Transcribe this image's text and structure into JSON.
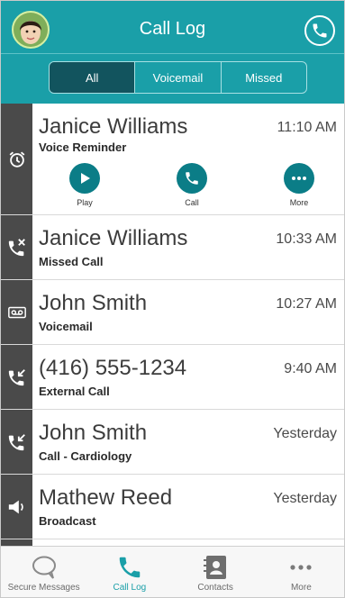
{
  "header": {
    "title": "Call Log",
    "avatar_icon": "user-avatar",
    "call_icon": "phone-icon"
  },
  "filter_tabs": [
    {
      "label": "All",
      "active": true
    },
    {
      "label": "Voicemail",
      "active": false
    },
    {
      "label": "Missed",
      "active": false
    }
  ],
  "calls": [
    {
      "name": "Janice Williams",
      "type": "Voice Reminder",
      "time": "11:10 AM",
      "icon": "alarm-clock-icon",
      "expanded": true
    },
    {
      "name": "Janice Williams",
      "type": "Missed Call",
      "time": "10:33 AM",
      "icon": "missed-call-icon"
    },
    {
      "name": "John Smith",
      "type": "Voicemail",
      "time": "10:27 AM",
      "icon": "voicemail-icon"
    },
    {
      "name": "(416) 555-1234",
      "type": "External Call",
      "time": "9:40 AM",
      "icon": "incoming-call-icon"
    },
    {
      "name": "John Smith",
      "type": "Call - Cardiology",
      "time": "Yesterday",
      "icon": "incoming-call-icon"
    },
    {
      "name": "Mathew Reed",
      "type": "Broadcast",
      "time": "Yesterday",
      "icon": "broadcast-speaker-icon"
    }
  ],
  "row_actions": [
    {
      "label": "Play",
      "icon": "play-icon"
    },
    {
      "label": "Call",
      "icon": "phone-icon"
    },
    {
      "label": "More",
      "icon": "more-dots-icon"
    }
  ],
  "bottom_tabs": [
    {
      "label": "Secure Messages",
      "icon": "chat-bubble-icon",
      "active": false
    },
    {
      "label": "Call Log",
      "icon": "phone-icon",
      "active": true
    },
    {
      "label": "Contacts",
      "icon": "contacts-book-icon",
      "active": false
    },
    {
      "label": "More",
      "icon": "more-dots-icon",
      "active": false
    }
  ],
  "colors": {
    "header": "#1a9fa8",
    "active_segment": "#12545e",
    "rail": "#4a4a4a",
    "action_button": "#0b7d87",
    "active_tab": "#1a9fa8"
  }
}
